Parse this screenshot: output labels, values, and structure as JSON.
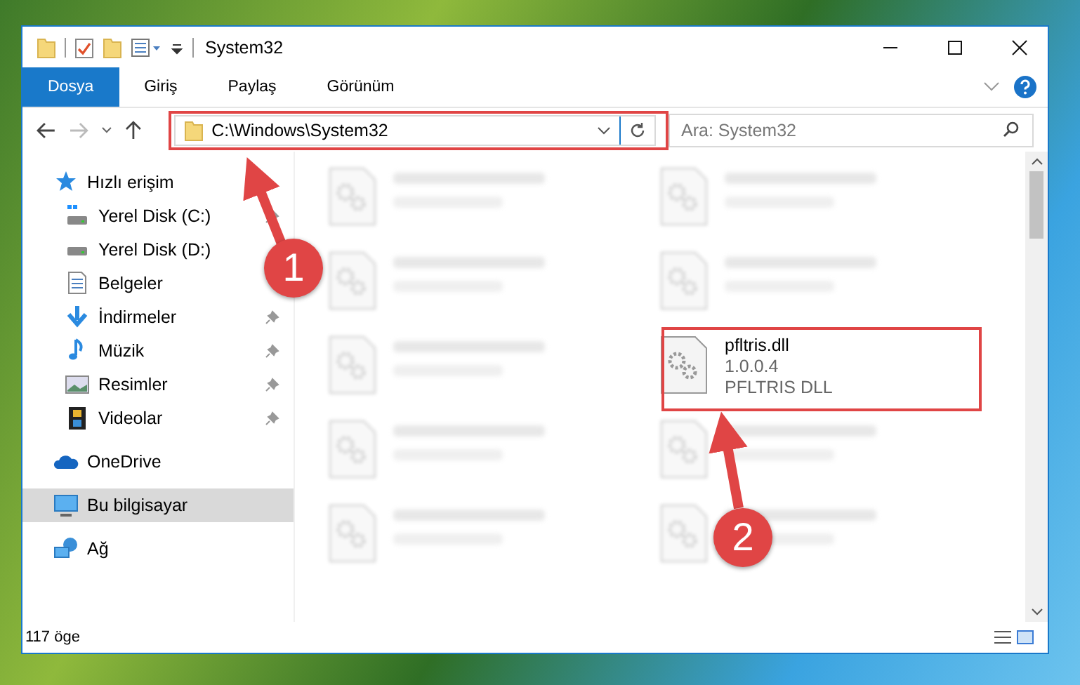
{
  "window": {
    "title": "System32"
  },
  "ribbon_tabs": [
    {
      "label": "Dosya",
      "selected": true
    },
    {
      "label": "Giriş",
      "selected": false
    },
    {
      "label": "Paylaş",
      "selected": false
    },
    {
      "label": "Görünüm",
      "selected": false
    }
  ],
  "address": {
    "path": "C:\\Windows\\System32"
  },
  "search": {
    "placeholder": "Ara: System32"
  },
  "sidebar": {
    "items": [
      {
        "label": "Hızlı erişim",
        "kind": "star",
        "selected": false,
        "children": [
          {
            "label": "Yerel Disk (C:)",
            "kind": "windisk",
            "pinned": true,
            "selected": false
          },
          {
            "label": "Yerel Disk (D:)",
            "kind": "disk",
            "pinned": false,
            "selected": false
          },
          {
            "label": "Belgeler",
            "kind": "doc",
            "pinned": false,
            "selected": false
          },
          {
            "label": "İndirmeler",
            "kind": "download",
            "pinned": true,
            "selected": false
          },
          {
            "label": "Müzik",
            "kind": "music",
            "pinned": true,
            "selected": false
          },
          {
            "label": "Resimler",
            "kind": "pictures",
            "pinned": true,
            "selected": false
          },
          {
            "label": "Videolar",
            "kind": "video",
            "pinned": true,
            "selected": false
          }
        ]
      },
      {
        "label": "OneDrive",
        "kind": "cloud",
        "selected": false
      },
      {
        "label": "Bu bilgisayar",
        "kind": "computer",
        "selected": true
      },
      {
        "label": "Ağ",
        "kind": "network",
        "selected": false
      }
    ]
  },
  "files": [
    {
      "blurred": true
    },
    {
      "blurred": true
    },
    {
      "blurred": true
    },
    {
      "blurred": true
    },
    {
      "blurred": true
    },
    {
      "name": "pfltris.dll",
      "version": "1.0.0.4",
      "type": "PFLTRIS DLL",
      "blurred": false,
      "highlighted": true
    },
    {
      "blurred": true
    },
    {
      "blurred": true
    },
    {
      "blurred": true
    },
    {
      "blurred": true
    }
  ],
  "status_bar": {
    "count": "117 öge"
  },
  "annotations": [
    {
      "label": "1"
    },
    {
      "label": "2"
    }
  ]
}
